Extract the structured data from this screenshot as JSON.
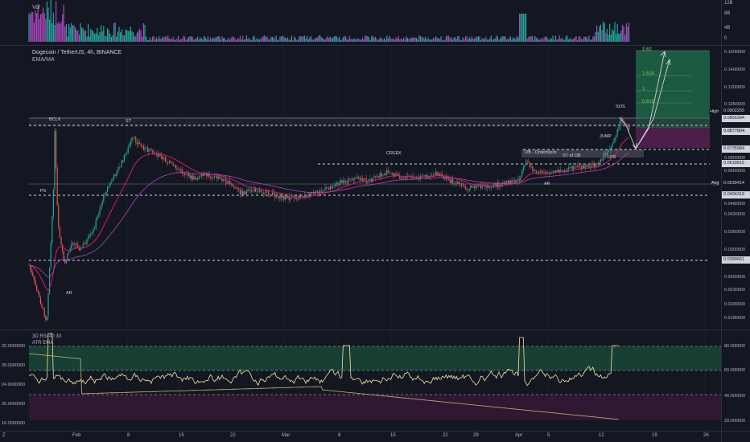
{
  "colors": {
    "bg": "#131722",
    "grid": "#1e222d",
    "up": "#26a69a",
    "down": "#ef5350",
    "ema": "#d81b60",
    "level": "#d1d4dc",
    "green_zone": "#1b5e3b",
    "purple_zone": "#4a1c48",
    "rsi": "#f5e6a6",
    "atr": "#d8c48a",
    "vol_up": "#26a69a",
    "vol_down": "#ab47bc",
    "axis_text": "#b2b5be"
  },
  "volume_pane": {
    "title": "Vol",
    "axis_labels": [
      "12B",
      "8B",
      "4B",
      "0"
    ]
  },
  "main_pane": {
    "symbol_title": "Dogecoin / TetherUS, 4h, BINANCE",
    "indicator_title": "EMA/MA",
    "axis_labels": [
      "0.1600000",
      "0.1400000",
      "0.1200000",
      "0.1050000",
      "0.0900000",
      "0.0800000",
      "0.0600000",
      "0.0480000",
      "0.0420000",
      "0.0360000",
      "0.0300000",
      "0.0250000",
      "0.0230000",
      "0.0200000",
      "0.0180000"
    ],
    "price_tags": [
      {
        "label": "",
        "value": "0.0902255",
        "style": "plain"
      },
      {
        "label": "",
        "value": "0.0855394",
        "style": "boxed"
      },
      {
        "label": "",
        "value": "0.0877804",
        "style": "boxed"
      },
      {
        "label": "",
        "value": "0.0735984",
        "style": "boxed"
      },
      {
        "label": "",
        "value": "0.0618815",
        "style": "boxed"
      },
      {
        "label": "",
        "value": "0.0539414",
        "style": "plain"
      },
      {
        "label": "",
        "value": "0.0494318",
        "style": "boxed"
      },
      {
        "label": "",
        "value": "0.0289661",
        "style": "boxed"
      }
    ],
    "side_labels": {
      "high": "High",
      "avg": "Avg"
    },
    "annotations": [
      "BCLX",
      "ST",
      "PS",
      "AR",
      "CREEK",
      "OB - Orderblock",
      "ST of OB",
      "AR",
      "JUMP",
      "SOS",
      "LPS"
    ],
    "fib_labels": [
      "2.62",
      "1.618",
      "1",
      "0.618"
    ]
  },
  "rsi_pane": {
    "title": "3D RSI 40 30",
    "subtitle": "ATR EMA",
    "left_axis": [
      "32.0000000",
      "28.0000000",
      "24.0000000",
      "20.0000000",
      "16.0000000"
    ],
    "right_axis": [
      "80.000000",
      "60.000000",
      "40.000000",
      "20.000000"
    ]
  },
  "time_axis": {
    "labels": [
      "Feb",
      "8",
      "15",
      "22",
      "Mar",
      "8",
      "15",
      "22",
      "29",
      "Apr",
      "5",
      "12",
      "19",
      "26"
    ],
    "corner": "Z"
  }
}
